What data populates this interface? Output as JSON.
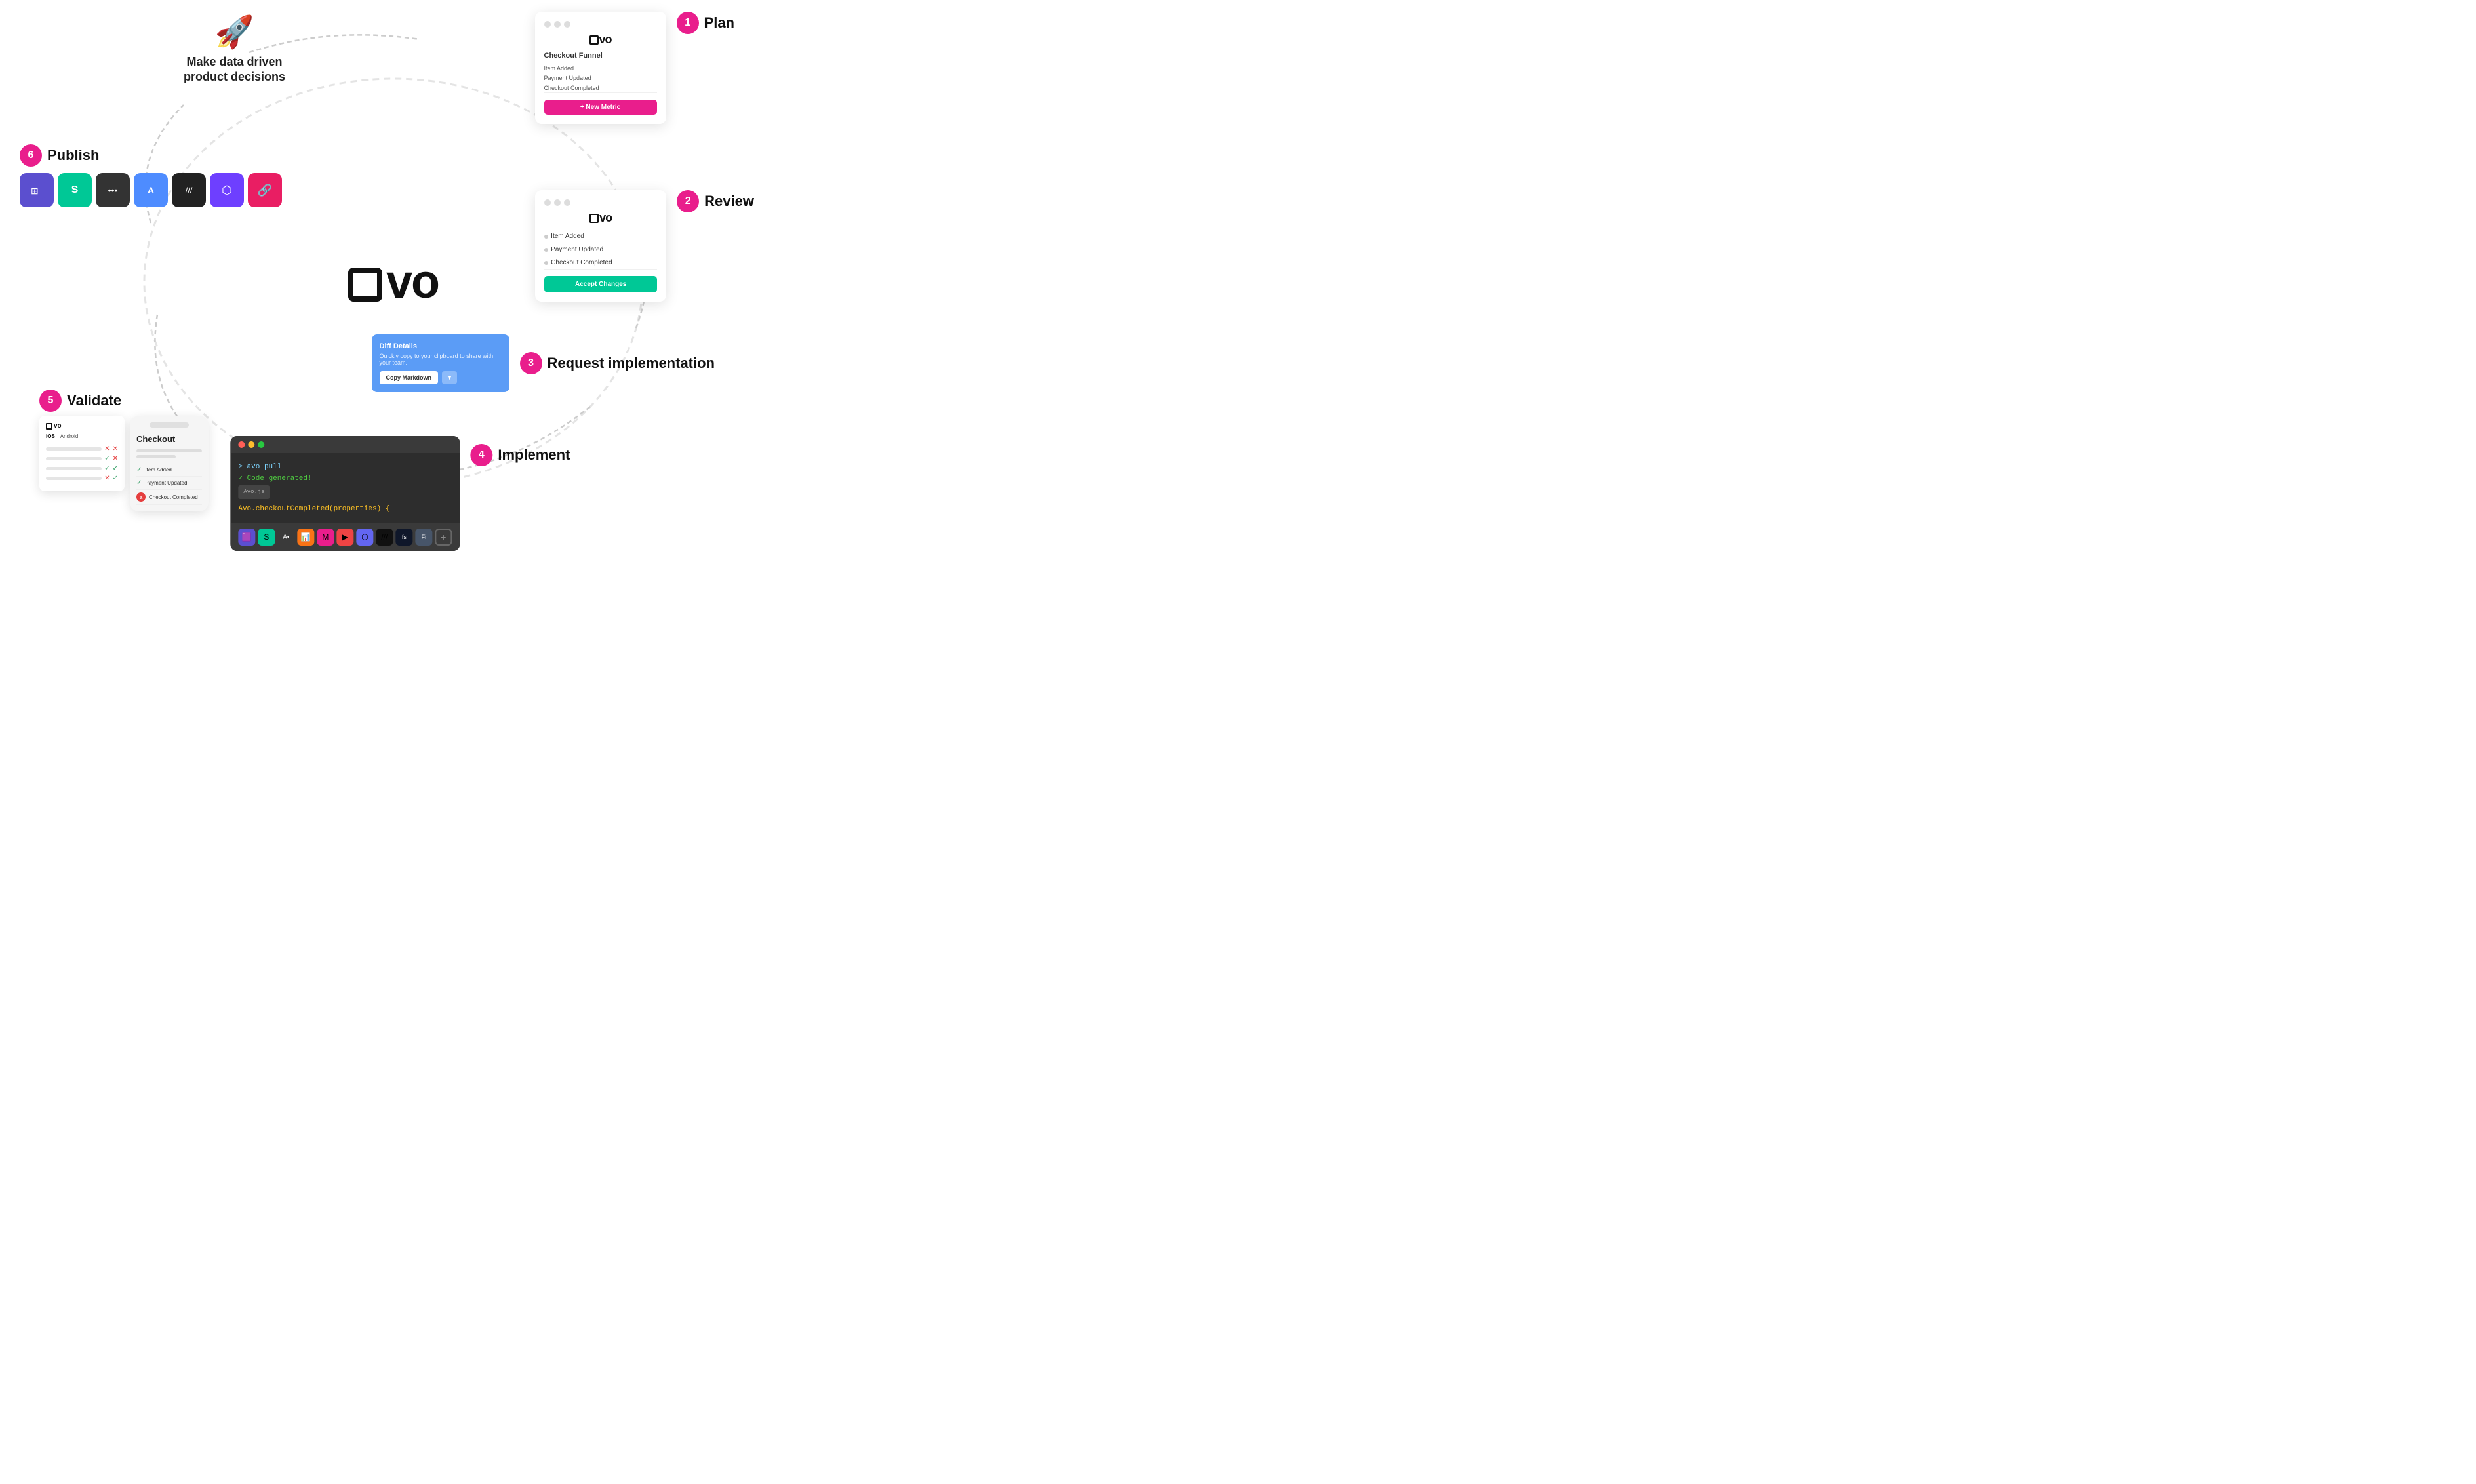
{
  "logo": {
    "text": "avo"
  },
  "tagline": {
    "emoji": "🚀",
    "line1": "Make data driven",
    "line2": "product decisions"
  },
  "steps": {
    "step1": {
      "number": "1",
      "label": "Plan",
      "card": {
        "brand": "avo",
        "title": "Checkout Funnel",
        "events": [
          "Item Added",
          "Payment Updated",
          "Checkout Completed"
        ],
        "button_label": "+ New Metric"
      }
    },
    "step2": {
      "number": "2",
      "label": "Review",
      "card": {
        "brand": "avo",
        "events": [
          "Item Added",
          "Payment Updated",
          "Checkout Completed"
        ],
        "button_label": "Accept Changes"
      }
    },
    "step3": {
      "number": "3",
      "label": "Request implementation",
      "card": {
        "title": "Diff Details",
        "subtitle": "Quickly copy to your clipboard to share with your team.",
        "button_label": "Copy Markdown",
        "dropdown_label": "▼"
      }
    },
    "step4": {
      "number": "4",
      "label": "Implement",
      "code": {
        "command": "> avo pull",
        "success": "✓  Code generated!",
        "file_tab": "Avo.js",
        "code_line": "Avo.checkoutCompleted(properties) {"
      }
    },
    "step5": {
      "number": "5",
      "label": "Validate",
      "table": {
        "platforms": [
          "iOS",
          "Android"
        ],
        "rows": [
          {
            "status_ios": "x",
            "status_android": "x"
          },
          {
            "status_ios": "check",
            "status_android": "x"
          },
          {
            "status_ios": "check",
            "status_android": "check"
          },
          {
            "status_ios": "x",
            "status_android": "check"
          }
        ]
      },
      "phone": {
        "title": "Checkout",
        "events": [
          {
            "label": "Item Added",
            "status": "check"
          },
          {
            "label": "Payment Updated",
            "status": "check"
          },
          {
            "label": "Checkout Completed",
            "status": "error"
          }
        ]
      }
    },
    "step6": {
      "number": "6",
      "label": "Publish",
      "icons": [
        "🟪",
        "🟢",
        "⬛",
        "🔵",
        "⬛",
        "🟣",
        "🔴"
      ]
    }
  },
  "integrations": {
    "icons": [
      "🟪",
      "🟢",
      "🔵",
      "🟠",
      "🟣",
      "🔴",
      "🟦",
      "⬛",
      "🟪",
      "➕"
    ]
  }
}
